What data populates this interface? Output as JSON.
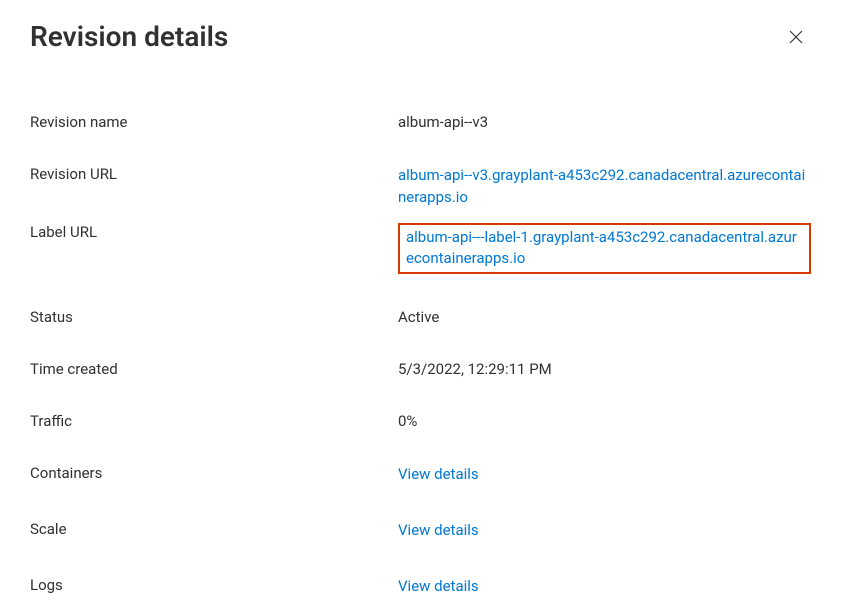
{
  "header": {
    "title": "Revision details"
  },
  "fields": {
    "revision_name": {
      "label": "Revision name",
      "value": "album-api--v3"
    },
    "revision_url": {
      "label": "Revision URL",
      "value": "album-api--v3.grayplant-a453c292.canadacentral.azurecontainerapps.io"
    },
    "label_url": {
      "label": "Label URL",
      "value": "album-api---label-1.grayplant-a453c292.canadacentral.azurecontainerapps.io"
    },
    "status": {
      "label": "Status",
      "value": "Active"
    },
    "time_created": {
      "label": "Time created",
      "value": "5/3/2022, 12:29:11 PM"
    },
    "traffic": {
      "label": "Traffic",
      "value": "0%"
    },
    "containers": {
      "label": "Containers",
      "link": "View details"
    },
    "scale": {
      "label": "Scale",
      "link": "View details"
    },
    "logs": {
      "label": "Logs",
      "link": "View details"
    }
  }
}
